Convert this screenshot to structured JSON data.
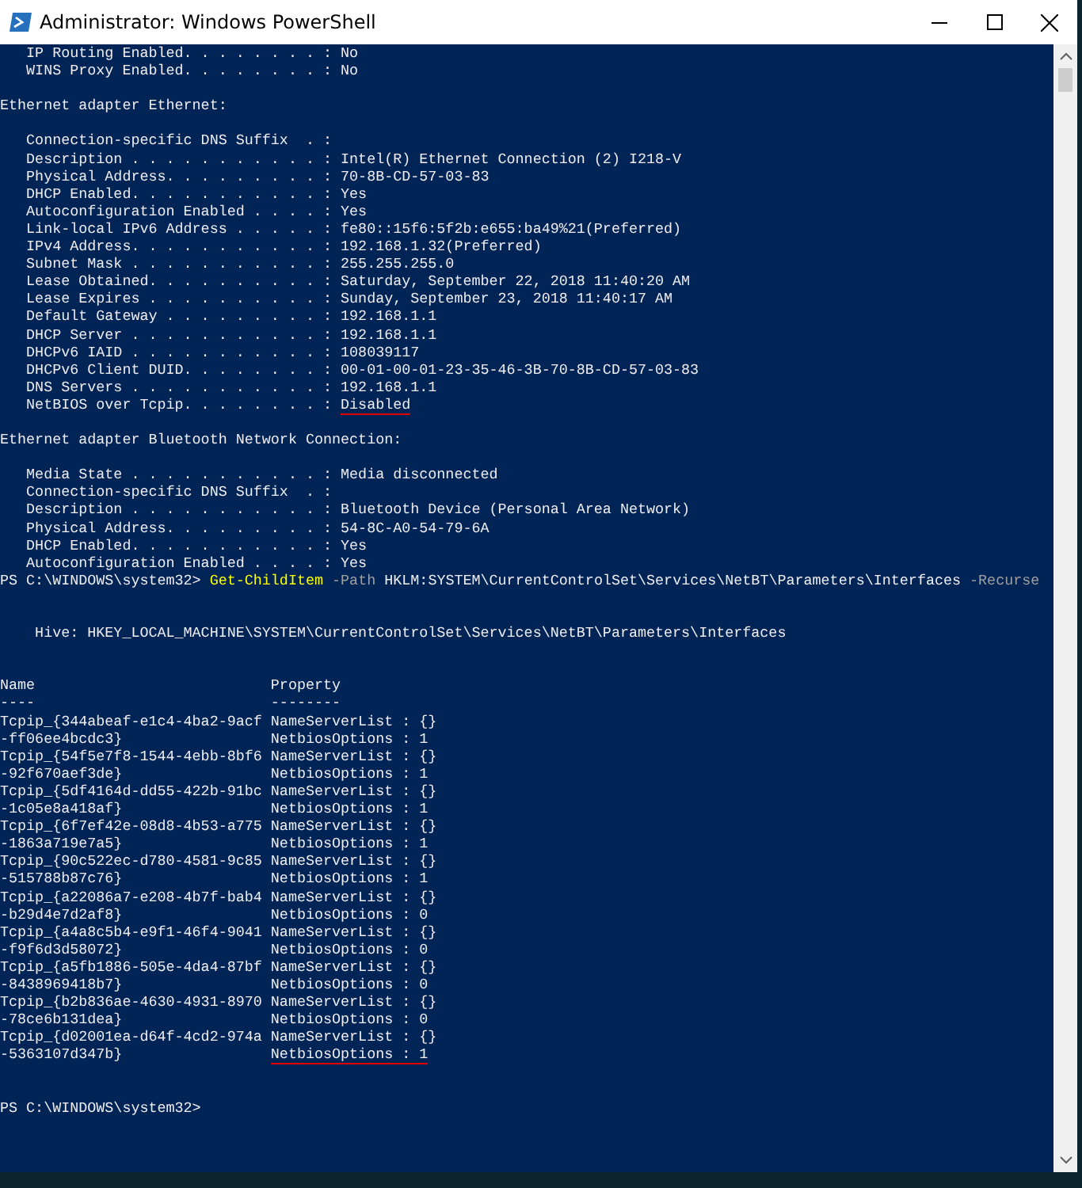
{
  "window": {
    "title": "Administrator: Windows PowerShell"
  },
  "console": {
    "lines": [
      {
        "kind": "text",
        "parts": [
          {
            "kind": "output",
            "text": "   IP Routing Enabled. . . . . . . . : No"
          }
        ]
      },
      {
        "kind": "text",
        "parts": [
          {
            "kind": "output",
            "text": "   WINS Proxy Enabled. . . . . . . . : No"
          }
        ]
      },
      {
        "kind": "blank"
      },
      {
        "kind": "text",
        "parts": [
          {
            "kind": "output",
            "text": "Ethernet adapter Ethernet:"
          }
        ]
      },
      {
        "kind": "blank"
      },
      {
        "kind": "text",
        "parts": [
          {
            "kind": "output",
            "text": "   Connection-specific DNS Suffix  . :"
          }
        ]
      },
      {
        "kind": "text",
        "parts": [
          {
            "kind": "output",
            "text": "   Description . . . . . . . . . . . : Intel(R) Ethernet Connection (2) I218-V"
          }
        ]
      },
      {
        "kind": "text",
        "parts": [
          {
            "kind": "output",
            "text": "   Physical Address. . . . . . . . . : 70-8B-CD-57-03-83"
          }
        ]
      },
      {
        "kind": "text",
        "parts": [
          {
            "kind": "output",
            "text": "   DHCP Enabled. . . . . . . . . . . : Yes"
          }
        ]
      },
      {
        "kind": "text",
        "parts": [
          {
            "kind": "output",
            "text": "   Autoconfiguration Enabled . . . . : Yes"
          }
        ]
      },
      {
        "kind": "text",
        "parts": [
          {
            "kind": "output",
            "text": "   Link-local IPv6 Address . . . . . : fe80::15f6:5f2b:e655:ba49%21(Preferred)"
          }
        ]
      },
      {
        "kind": "text",
        "parts": [
          {
            "kind": "output",
            "text": "   IPv4 Address. . . . . . . . . . . : 192.168.1.32(Preferred)"
          }
        ]
      },
      {
        "kind": "text",
        "parts": [
          {
            "kind": "output",
            "text": "   Subnet Mask . . . . . . . . . . . : 255.255.255.0"
          }
        ]
      },
      {
        "kind": "text",
        "parts": [
          {
            "kind": "output",
            "text": "   Lease Obtained. . . . . . . . . . : Saturday, September 22, 2018 11:40:20 AM"
          }
        ]
      },
      {
        "kind": "text",
        "parts": [
          {
            "kind": "output",
            "text": "   Lease Expires . . . . . . . . . . : Sunday, September 23, 2018 11:40:17 AM"
          }
        ]
      },
      {
        "kind": "text",
        "parts": [
          {
            "kind": "output",
            "text": "   Default Gateway . . . . . . . . . : 192.168.1.1"
          }
        ]
      },
      {
        "kind": "text",
        "parts": [
          {
            "kind": "output",
            "text": "   DHCP Server . . . . . . . . . . . : 192.168.1.1"
          }
        ]
      },
      {
        "kind": "text",
        "parts": [
          {
            "kind": "output",
            "text": "   DHCPv6 IAID . . . . . . . . . . . : 108039117"
          }
        ]
      },
      {
        "kind": "text",
        "parts": [
          {
            "kind": "output",
            "text": "   DHCPv6 Client DUID. . . . . . . . : 00-01-00-01-23-35-46-3B-70-8B-CD-57-03-83"
          }
        ]
      },
      {
        "kind": "text",
        "parts": [
          {
            "kind": "output",
            "text": "   DNS Servers . . . . . . . . . . . : 192.168.1.1"
          }
        ]
      },
      {
        "kind": "text",
        "parts": [
          {
            "kind": "output",
            "text": "   NetBIOS over Tcpip. . . . . . . . : "
          },
          {
            "kind": "marked",
            "text": "Disabled"
          }
        ]
      },
      {
        "kind": "blank"
      },
      {
        "kind": "text",
        "parts": [
          {
            "kind": "output",
            "text": "Ethernet adapter Bluetooth Network Connection:"
          }
        ]
      },
      {
        "kind": "blank"
      },
      {
        "kind": "text",
        "parts": [
          {
            "kind": "output",
            "text": "   Media State . . . . . . . . . . . : Media disconnected"
          }
        ]
      },
      {
        "kind": "text",
        "parts": [
          {
            "kind": "output",
            "text": "   Connection-specific DNS Suffix  . :"
          }
        ]
      },
      {
        "kind": "text",
        "parts": [
          {
            "kind": "output",
            "text": "   Description . . . . . . . . . . . : Bluetooth Device (Personal Area Network)"
          }
        ]
      },
      {
        "kind": "text",
        "parts": [
          {
            "kind": "output",
            "text": "   Physical Address. . . . . . . . . : 54-8C-A0-54-79-6A"
          }
        ]
      },
      {
        "kind": "text",
        "parts": [
          {
            "kind": "output",
            "text": "   DHCP Enabled. . . . . . . . . . . : Yes"
          }
        ]
      },
      {
        "kind": "text",
        "parts": [
          {
            "kind": "output",
            "text": "   Autoconfiguration Enabled . . . . : Yes"
          }
        ]
      },
      {
        "kind": "text",
        "parts": [
          {
            "kind": "output",
            "text": "PS C:\\WINDOWS\\system32> "
          },
          {
            "kind": "command",
            "text": "Get-ChildItem"
          },
          {
            "kind": "parameter",
            "text": " -Path"
          },
          {
            "kind": "argument",
            "text": " HKLM:SYSTEM\\CurrentControlSet\\Services\\NetBT\\Parameters\\Interfaces"
          },
          {
            "kind": "parameter",
            "text": " -Recurse"
          }
        ]
      },
      {
        "kind": "blank"
      },
      {
        "kind": "blank"
      },
      {
        "kind": "text",
        "parts": [
          {
            "kind": "output",
            "text": "    Hive: HKEY_LOCAL_MACHINE\\SYSTEM\\CurrentControlSet\\Services\\NetBT\\Parameters\\Interfaces"
          }
        ]
      },
      {
        "kind": "blank"
      },
      {
        "kind": "blank"
      },
      {
        "kind": "text",
        "parts": [
          {
            "kind": "output",
            "text": "Name                           Property"
          }
        ]
      },
      {
        "kind": "text",
        "parts": [
          {
            "kind": "output",
            "text": "----                           --------"
          }
        ]
      },
      {
        "kind": "text",
        "parts": [
          {
            "kind": "output",
            "text": "Tcpip_{344abeaf-e1c4-4ba2-9acf NameServerList : {}"
          }
        ]
      },
      {
        "kind": "text",
        "parts": [
          {
            "kind": "output",
            "text": "-ff06ee4bcdc3}                 NetbiosOptions : 1"
          }
        ]
      },
      {
        "kind": "text",
        "parts": [
          {
            "kind": "output",
            "text": "Tcpip_{54f5e7f8-1544-4ebb-8bf6 NameServerList : {}"
          }
        ]
      },
      {
        "kind": "text",
        "parts": [
          {
            "kind": "output",
            "text": "-92f670aef3de}                 NetbiosOptions : 1"
          }
        ]
      },
      {
        "kind": "text",
        "parts": [
          {
            "kind": "output",
            "text": "Tcpip_{5df4164d-dd55-422b-91bc NameServerList : {}"
          }
        ]
      },
      {
        "kind": "text",
        "parts": [
          {
            "kind": "output",
            "text": "-1c05e8a418af}                 NetbiosOptions : 1"
          }
        ]
      },
      {
        "kind": "text",
        "parts": [
          {
            "kind": "output",
            "text": "Tcpip_{6f7ef42e-08d8-4b53-a775 NameServerList : {}"
          }
        ]
      },
      {
        "kind": "text",
        "parts": [
          {
            "kind": "output",
            "text": "-1863a719e7a5}                 NetbiosOptions : 1"
          }
        ]
      },
      {
        "kind": "text",
        "parts": [
          {
            "kind": "output",
            "text": "Tcpip_{90c522ec-d780-4581-9c85 NameServerList : {}"
          }
        ]
      },
      {
        "kind": "text",
        "parts": [
          {
            "kind": "output",
            "text": "-515788b87c76}                 NetbiosOptions : 1"
          }
        ]
      },
      {
        "kind": "text",
        "parts": [
          {
            "kind": "output",
            "text": "Tcpip_{a22086a7-e208-4b7f-bab4 NameServerList : {}"
          }
        ]
      },
      {
        "kind": "text",
        "parts": [
          {
            "kind": "output",
            "text": "-b29d4e7d2af8}                 NetbiosOptions : 0"
          }
        ]
      },
      {
        "kind": "text",
        "parts": [
          {
            "kind": "output",
            "text": "Tcpip_{a4a8c5b4-e9f1-46f4-9041 NameServerList : {}"
          }
        ]
      },
      {
        "kind": "text",
        "parts": [
          {
            "kind": "output",
            "text": "-f9f6d3d58072}                 NetbiosOptions : 0"
          }
        ]
      },
      {
        "kind": "text",
        "parts": [
          {
            "kind": "output",
            "text": "Tcpip_{a5fb1886-505e-4da4-87bf NameServerList : {}"
          }
        ]
      },
      {
        "kind": "text",
        "parts": [
          {
            "kind": "output",
            "text": "-8438969418b7}                 NetbiosOptions : 0"
          }
        ]
      },
      {
        "kind": "text",
        "parts": [
          {
            "kind": "output",
            "text": "Tcpip_{b2b836ae-4630-4931-8970 NameServerList : {}"
          }
        ]
      },
      {
        "kind": "text",
        "parts": [
          {
            "kind": "output",
            "text": "-78ce6b131dea}                 NetbiosOptions : 0"
          }
        ]
      },
      {
        "kind": "text",
        "parts": [
          {
            "kind": "output",
            "text": "Tcpip_{d02001ea-d64f-4cd2-974a NameServerList : {}"
          }
        ]
      },
      {
        "kind": "text",
        "parts": [
          {
            "kind": "output",
            "text": "-5363107d347b}                 "
          },
          {
            "kind": "marked",
            "text": "NetbiosOptions : 1"
          }
        ]
      },
      {
        "kind": "blank"
      },
      {
        "kind": "blank"
      },
      {
        "kind": "text",
        "parts": [
          {
            "kind": "output",
            "text": "PS C:\\WINDOWS\\system32>"
          }
        ]
      }
    ]
  }
}
